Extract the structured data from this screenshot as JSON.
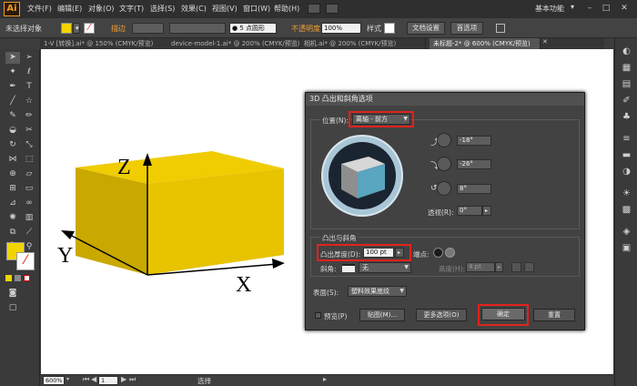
{
  "app": {
    "logo": "Ai"
  },
  "menu": [
    "文件(F)",
    "编辑(E)",
    "对象(O)",
    "文字(T)",
    "选择(S)",
    "效果(C)",
    "视图(V)",
    "窗口(W)",
    "帮助(H)"
  ],
  "workspace": "基本功能",
  "control_bar": {
    "selection_status": "未选择对象",
    "stroke_label": "描边",
    "brush_label": "5 点圆形",
    "opacity_label": "不透明度",
    "opacity_value": "100%",
    "style_label": "样式",
    "doc_setup_button": "文档设置",
    "prefs_button": "首选项"
  },
  "tabs": [
    {
      "label": "1-V [转换].ai* @ 150% (CMYK/预览)",
      "active": false
    },
    {
      "label": "device-model-1.ai* @ 200% (CMYK/预览)",
      "active": false
    },
    {
      "label": "相机.ai* @ 200% (CMYK/预览)",
      "active": false
    },
    {
      "label": "未标题-2* @ 600% (CMYK/预览)",
      "active": true
    }
  ],
  "artwork": {
    "axis_z": "Z",
    "axis_y": "Y",
    "axis_x": "X",
    "box_color": "#e8c300"
  },
  "dialog": {
    "title": "3D 凸出和斜角选项",
    "position_label": "位置(N):",
    "position_value": "离轴 - 前方",
    "rot_x": "-18°",
    "rot_y": "-26°",
    "rot_z": "8°",
    "perspective_label": "透视(R):",
    "perspective_value": "0°",
    "extrude_section": "凸出与斜角",
    "depth_label": "凸出厚度(D):",
    "depth_value": "100 pt",
    "cap_label": "端点:",
    "bevel_label": "斜角:",
    "bevel_value": "无",
    "height_label": "高度(H):",
    "height_value": "4 pt",
    "surface_label": "表面(S):",
    "surface_value": "塑料效果底纹",
    "preview_label": "预览(P)",
    "map_button": "贴图(M)...",
    "more_button": "更多选项(O)",
    "ok_button": "确定",
    "reset_button": "重置"
  },
  "status": {
    "zoom": "600%",
    "page": "1",
    "tool": "选择"
  }
}
